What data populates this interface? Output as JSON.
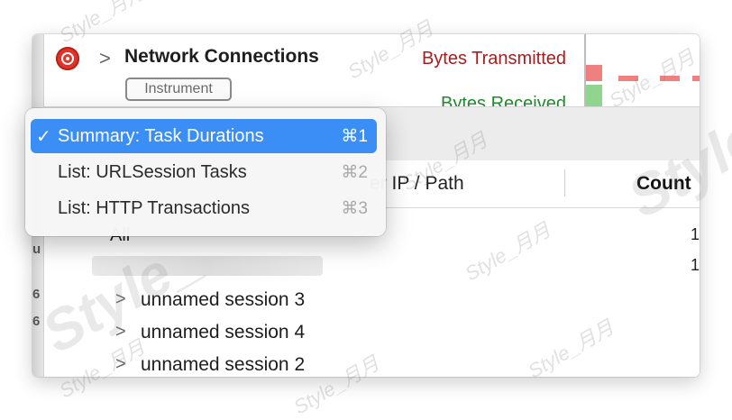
{
  "track": {
    "title": "Network Connections",
    "badge": "Instrument",
    "bytes_transmitted": "Bytes Transmitted",
    "bytes_received": "Bytes Received",
    "disclosure": ">"
  },
  "colors": {
    "transmitted": "#f08080",
    "received": "#8fd48f",
    "selection": "#3a8ef6"
  },
  "dropdown": {
    "items": [
      {
        "label": "Summary: Task Durations",
        "shortcut": "⌘1",
        "checked": true
      },
      {
        "label": "List: URLSession Tasks",
        "shortcut": "⌘2",
        "checked": false
      },
      {
        "label": "List: HTTP Transactions",
        "shortcut": "⌘3",
        "checked": false
      }
    ],
    "checkmark": "✓"
  },
  "table": {
    "columns": {
      "path": "er IP / Path",
      "count": "Count"
    },
    "all_label": "All",
    "counts": [
      "1",
      "1"
    ],
    "sessions": [
      {
        "name": "unnamed session 3"
      },
      {
        "name": "unnamed session 4"
      },
      {
        "name": "unnamed session 2"
      }
    ],
    "chevron": ">"
  },
  "left_edge_digits": [
    "u",
    "6",
    "6"
  ],
  "watermark_text": "Style_月月",
  "watermark_big_text": "Style_"
}
